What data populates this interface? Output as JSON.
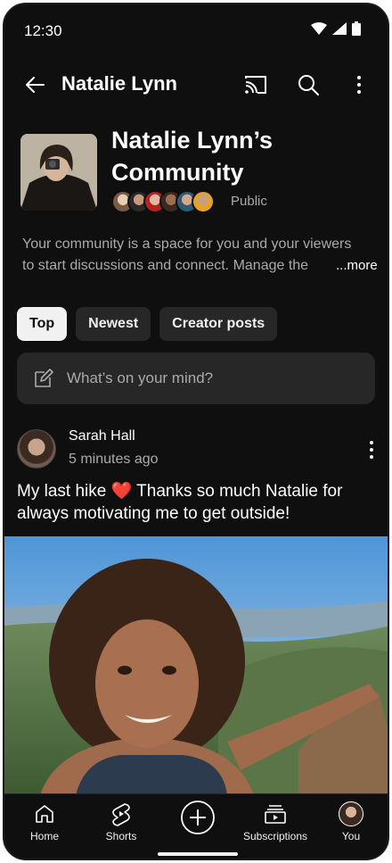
{
  "status_bar": {
    "time": "12:30"
  },
  "app_bar": {
    "title": "Natalie Lynn"
  },
  "community": {
    "title": "Natalie Lynn’s Community",
    "visibility": "Public",
    "description_line1": "Your community is a space for you and your viewers",
    "description_line2": "to start discussions and connect. Manage the",
    "more_label": "...more",
    "member_avatar_colors": [
      "#d8c4b0",
      "#8d6a52",
      "#c0392b",
      "#5d4637",
      "#3a6f8f",
      "#e0a030"
    ]
  },
  "filters": {
    "chips": [
      "Top",
      "Newest",
      "Creator posts"
    ],
    "selected": "Top"
  },
  "composer": {
    "placeholder": "What’s on your mind?"
  },
  "post": {
    "author": "Sarah Hall",
    "time": "5 minutes ago",
    "text": "My last hike ❤️ Thanks so much Natalie for always motivating me to get outside!"
  },
  "bottom_nav": {
    "items": [
      {
        "label": "Home",
        "icon": "home-icon"
      },
      {
        "label": "Shorts",
        "icon": "shorts-icon"
      },
      {
        "label": "",
        "icon": "create-icon"
      },
      {
        "label": "Subscriptions",
        "icon": "subscriptions-icon"
      },
      {
        "label": "You",
        "icon": "you-avatar"
      }
    ]
  }
}
